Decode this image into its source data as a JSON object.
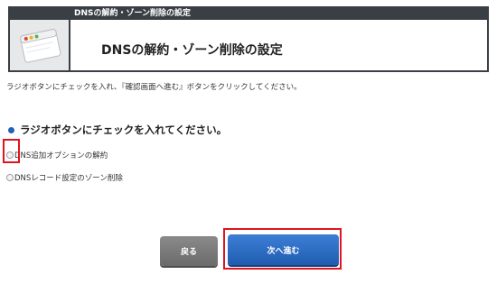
{
  "header": {
    "bar_title": "DNSの解約・ゾーン削除の設定",
    "title": "DNSの解約・ゾーン削除の設定",
    "icon": "browser-window-icon"
  },
  "instruction": "ラジオボタンにチェックを入れ、『確認画面へ進む』ボタンをクリックしてください。",
  "section_heading": "ラジオボタンにチェックを入れてください。",
  "options": [
    {
      "label": "DNS追加オプションの解約",
      "checked": false
    },
    {
      "label": "DNSレコード設定のゾーン削除",
      "checked": false
    }
  ],
  "buttons": {
    "back": "戻る",
    "next": "次へ進む"
  },
  "colors": {
    "header_dark": "#3a3f45",
    "accent_blue": "#1f62b8",
    "highlight_red": "#e0141e",
    "back_button": "#777777"
  }
}
